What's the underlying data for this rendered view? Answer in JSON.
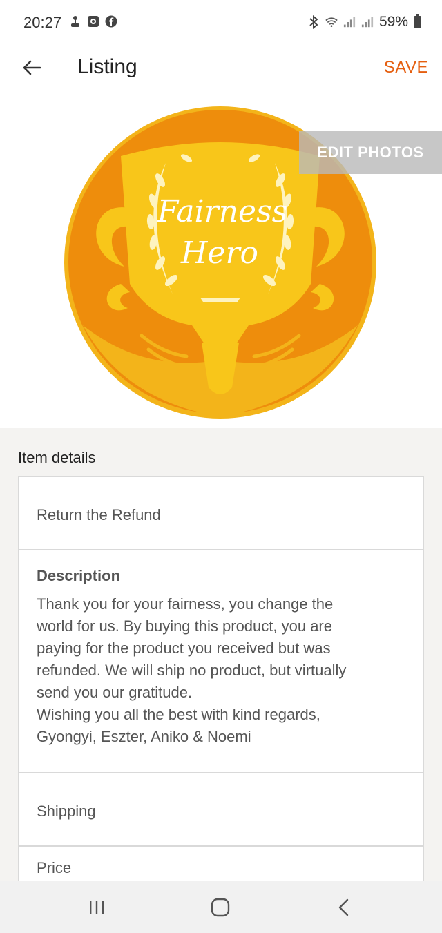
{
  "status": {
    "time": "20:27",
    "battery": "59%",
    "left_icons": [
      "usb-icon",
      "screen-record-icon",
      "facebook-icon"
    ],
    "right_icons": [
      "bluetooth-icon",
      "wifi-icon",
      "signal-icon",
      "signal-icon"
    ]
  },
  "appbar": {
    "title": "Listing",
    "save_label": "SAVE"
  },
  "photo": {
    "edit_label": "EDIT PHOTOS",
    "image_text_line1": "Fairness",
    "image_text_line2": "Hero"
  },
  "item_details": {
    "section_label": "Item details",
    "title_value": "Return the Refund",
    "description_label": "Description",
    "description_text": "Thank you for your fairness, you change the\nworld for us. By buying this product, you are\npaying for the product you received but was\nrefunded. We will ship no product, but virtually\nsend you our gratitude.\nWishing you all the best with kind regards,\nGyongyi, Eszter, Aniko & Noemi",
    "shipping_label": "Shipping",
    "price_label": "Price"
  },
  "colors": {
    "accent": "#e55f10",
    "medal_outer": "#f3b41a",
    "medal_orange": "#ee8d0c",
    "medal_yellow": "#f8c61a"
  }
}
